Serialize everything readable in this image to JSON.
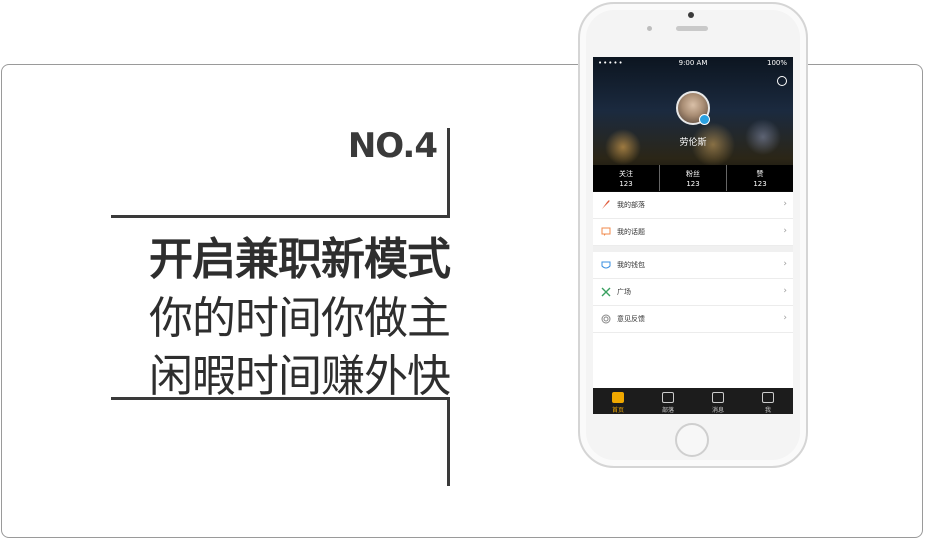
{
  "promo": {
    "number": "NO.4",
    "headline": "开启兼职新模式",
    "line1": "你的时间你做主",
    "line2": "闲暇时间赚外快"
  },
  "status_bar": {
    "signal": "•••••",
    "time": "9:00 AM",
    "battery": "100%"
  },
  "profile": {
    "username": "劳伦斯"
  },
  "stats": [
    {
      "label": "关注",
      "value": "123"
    },
    {
      "label": "粉丝",
      "value": "123"
    },
    {
      "label": "赞",
      "value": "123"
    }
  ],
  "menu": {
    "group1": [
      {
        "label": "我的部落",
        "icon": "feather-icon",
        "color": "#e05a3a"
      },
      {
        "label": "我的话题",
        "icon": "chat-screen-icon",
        "color": "#f08a4b"
      }
    ],
    "group2": [
      {
        "label": "我的钱包",
        "icon": "wallet-icon",
        "color": "#3a8fe0"
      },
      {
        "label": "广场",
        "icon": "tools-icon",
        "color": "#3aa060"
      },
      {
        "label": "意见反馈",
        "icon": "feedback-circle-icon",
        "color": "#888888"
      }
    ],
    "chevron": "›"
  },
  "tabs": [
    {
      "label": "首页",
      "icon": "home-tab-icon"
    },
    {
      "label": "部落",
      "icon": "tent-tab-icon"
    },
    {
      "label": "消息",
      "icon": "message-tab-icon"
    },
    {
      "label": "我",
      "icon": "me-tab-icon"
    }
  ],
  "colors": {
    "accent": "#f0a800",
    "text_dark": "#2e2e2e"
  }
}
